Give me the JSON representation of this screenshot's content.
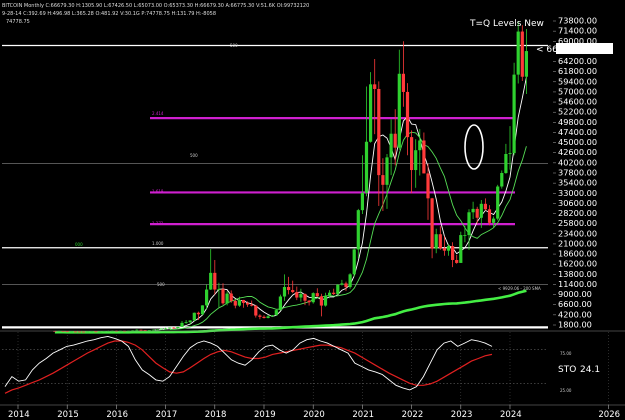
{
  "header": {
    "line1": "BITCOIN Monthly  C:66679.30  H:1305.90  L:67426.50  L:65073.00  O:65373.30  H:66679.30  A:66775.30  V:51.6K  OI:99732120",
    "line2": "9-28-14  C:392.69  H:496.98  L:365.28  O:481.92  V:30.1G  P:74778.75  H:131.79  H:-8058",
    "line3": "74778.75",
    "overlay_title": "T=Q Levels New"
  },
  "price_tag": "< 66679.3",
  "labels": {
    "level_500_top": "500",
    "level_2414": "2.414",
    "level_500_mid": "500",
    "level_1618": "1.618",
    "level_1272": "1.272",
    "level_1000": "1.000",
    "level_500_low": "500",
    "note_left": "000",
    "sma_label": "< 9929.06 - 200 SMA",
    "stoch_label": "STO",
    "stoch_value": "24.1",
    "stoch_80": "75.00",
    "stoch_20": "25.00"
  },
  "colors": {
    "up": "#2fd12f",
    "down": "#ff3a3a",
    "fib": "#d020d0",
    "white_line": "#ffffff",
    "ma_fast": "#ffffff",
    "ma_mid": "#55dd55",
    "ma_slow": "#44ee44",
    "stoch_k": "#ffffff",
    "stoch_d": "#e02020"
  },
  "chart_data": {
    "type": "candlestick",
    "title": "T=Q Levels New",
    "y_tick_labels": [
      "73800.00",
      "71400.00",
      "69000.00",
      "66600.00",
      "64200.00",
      "61800.00",
      "59400.00",
      "57000.00",
      "54600.00",
      "52200.00",
      "49800.00",
      "47400.00",
      "45000.00",
      "42600.00",
      "40200.00",
      "37800.00",
      "35400.00",
      "33000.00",
      "30600.00",
      "28200.00",
      "25800.00",
      "23400.00",
      "21000.00",
      "18600.00",
      "16200.00",
      "13800.00",
      "11400.00",
      "9000.00",
      "6600.00",
      "4200.00",
      "1800.00"
    ],
    "x_tick_labels": [
      "2014",
      "2015",
      "2016",
      "2017",
      "2018",
      "2019",
      "2020",
      "2021",
      "2022",
      "2023",
      "2024",
      "2026"
    ],
    "ylim": [
      0,
      75000
    ],
    "last_price": 66679.3,
    "candles": [
      {
        "t": "2014-10",
        "o": 390,
        "h": 400,
        "l": 310,
        "c": 340
      },
      {
        "t": "2014-11",
        "o": 340,
        "h": 460,
        "l": 320,
        "c": 380
      },
      {
        "t": "2014-12",
        "o": 380,
        "h": 390,
        "l": 300,
        "c": 320
      },
      {
        "t": "2015-01",
        "o": 320,
        "h": 320,
        "l": 150,
        "c": 220
      },
      {
        "t": "2015-02",
        "o": 220,
        "h": 270,
        "l": 210,
        "c": 255
      },
      {
        "t": "2015-03",
        "o": 255,
        "h": 300,
        "l": 240,
        "c": 245
      },
      {
        "t": "2015-04",
        "o": 245,
        "h": 260,
        "l": 210,
        "c": 235
      },
      {
        "t": "2015-05",
        "o": 235,
        "h": 250,
        "l": 225,
        "c": 230
      },
      {
        "t": "2015-06",
        "o": 230,
        "h": 265,
        "l": 220,
        "c": 262
      },
      {
        "t": "2015-07",
        "o": 262,
        "h": 315,
        "l": 255,
        "c": 285
      },
      {
        "t": "2015-08",
        "o": 285,
        "h": 290,
        "l": 200,
        "c": 230
      },
      {
        "t": "2015-09",
        "o": 230,
        "h": 245,
        "l": 225,
        "c": 237
      },
      {
        "t": "2015-10",
        "o": 237,
        "h": 330,
        "l": 235,
        "c": 312
      },
      {
        "t": "2015-11",
        "o": 312,
        "h": 495,
        "l": 300,
        "c": 377
      },
      {
        "t": "2015-12",
        "o": 377,
        "h": 470,
        "l": 350,
        "c": 430
      },
      {
        "t": "2016-01",
        "o": 430,
        "h": 460,
        "l": 350,
        "c": 370
      },
      {
        "t": "2016-02",
        "o": 370,
        "h": 445,
        "l": 365,
        "c": 437
      },
      {
        "t": "2016-03",
        "o": 437,
        "h": 440,
        "l": 410,
        "c": 416
      },
      {
        "t": "2016-04",
        "o": 416,
        "h": 465,
        "l": 415,
        "c": 448
      },
      {
        "t": "2016-05",
        "o": 448,
        "h": 550,
        "l": 440,
        "c": 531
      },
      {
        "t": "2016-06",
        "o": 531,
        "h": 780,
        "l": 530,
        "c": 670
      },
      {
        "t": "2016-07",
        "o": 670,
        "h": 700,
        "l": 600,
        "c": 624
      },
      {
        "t": "2016-08",
        "o": 624,
        "h": 630,
        "l": 540,
        "c": 573
      },
      {
        "t": "2016-09",
        "o": 573,
        "h": 615,
        "l": 570,
        "c": 608
      },
      {
        "t": "2016-10",
        "o": 608,
        "h": 720,
        "l": 605,
        "c": 698
      },
      {
        "t": "2016-11",
        "o": 698,
        "h": 750,
        "l": 690,
        "c": 745
      },
      {
        "t": "2016-12",
        "o": 745,
        "h": 975,
        "l": 740,
        "c": 965
      },
      {
        "t": "2017-01",
        "o": 965,
        "h": 1150,
        "l": 750,
        "c": 970
      },
      {
        "t": "2017-02",
        "o": 970,
        "h": 1200,
        "l": 920,
        "c": 1190
      },
      {
        "t": "2017-03",
        "o": 1190,
        "h": 1300,
        "l": 890,
        "c": 1080
      },
      {
        "t": "2017-04",
        "o": 1080,
        "h": 1350,
        "l": 1060,
        "c": 1350
      },
      {
        "t": "2017-05",
        "o": 1350,
        "h": 2750,
        "l": 1340,
        "c": 2300
      },
      {
        "t": "2017-06",
        "o": 2300,
        "h": 2980,
        "l": 2100,
        "c": 2480
      },
      {
        "t": "2017-07",
        "o": 2480,
        "h": 2930,
        "l": 1830,
        "c": 2870
      },
      {
        "t": "2017-08",
        "o": 2870,
        "h": 4750,
        "l": 2680,
        "c": 4700
      },
      {
        "t": "2017-09",
        "o": 4700,
        "h": 4980,
        "l": 2980,
        "c": 4340
      },
      {
        "t": "2017-10",
        "o": 4340,
        "h": 6470,
        "l": 4150,
        "c": 6450
      },
      {
        "t": "2017-11",
        "o": 6450,
        "h": 11400,
        "l": 5500,
        "c": 10200
      },
      {
        "t": "2017-12",
        "o": 10200,
        "h": 19800,
        "l": 10100,
        "c": 14150
      },
      {
        "t": "2018-01",
        "o": 14150,
        "h": 17200,
        "l": 9000,
        "c": 10200
      },
      {
        "t": "2018-02",
        "o": 10200,
        "h": 11800,
        "l": 6000,
        "c": 10300
      },
      {
        "t": "2018-03",
        "o": 10300,
        "h": 11700,
        "l": 6600,
        "c": 6930
      },
      {
        "t": "2018-04",
        "o": 6930,
        "h": 9750,
        "l": 6450,
        "c": 9240
      },
      {
        "t": "2018-05",
        "o": 9240,
        "h": 9990,
        "l": 7050,
        "c": 7500
      },
      {
        "t": "2018-06",
        "o": 7500,
        "h": 7770,
        "l": 5750,
        "c": 6390
      },
      {
        "t": "2018-07",
        "o": 6390,
        "h": 8500,
        "l": 6100,
        "c": 7730
      },
      {
        "t": "2018-08",
        "o": 7730,
        "h": 7760,
        "l": 5880,
        "c": 7030
      },
      {
        "t": "2018-09",
        "o": 7030,
        "h": 7400,
        "l": 6100,
        "c": 6630
      },
      {
        "t": "2018-10",
        "o": 6630,
        "h": 7600,
        "l": 6200,
        "c": 6370
      },
      {
        "t": "2018-11",
        "o": 6370,
        "h": 6570,
        "l": 3560,
        "c": 4040
      },
      {
        "t": "2018-12",
        "o": 4040,
        "h": 4350,
        "l": 3150,
        "c": 3740
      },
      {
        "t": "2019-01",
        "o": 3740,
        "h": 4100,
        "l": 3350,
        "c": 3460
      },
      {
        "t": "2019-02",
        "o": 3460,
        "h": 4200,
        "l": 3380,
        "c": 3850
      },
      {
        "t": "2019-03",
        "o": 3850,
        "h": 4150,
        "l": 3680,
        "c": 4100
      },
      {
        "t": "2019-04",
        "o": 4100,
        "h": 5600,
        "l": 4050,
        "c": 5320
      },
      {
        "t": "2019-05",
        "o": 5320,
        "h": 9000,
        "l": 5300,
        "c": 8550
      },
      {
        "t": "2019-06",
        "o": 8550,
        "h": 13800,
        "l": 7500,
        "c": 10800
      },
      {
        "t": "2019-07",
        "o": 10800,
        "h": 13200,
        "l": 9050,
        "c": 10080
      },
      {
        "t": "2019-08",
        "o": 10080,
        "h": 12300,
        "l": 9350,
        "c": 9600
      },
      {
        "t": "2019-09",
        "o": 9600,
        "h": 10900,
        "l": 7700,
        "c": 8300
      },
      {
        "t": "2019-10",
        "o": 8300,
        "h": 10400,
        "l": 7300,
        "c": 9150
      },
      {
        "t": "2019-11",
        "o": 9150,
        "h": 9270,
        "l": 6500,
        "c": 7550
      },
      {
        "t": "2019-12",
        "o": 7550,
        "h": 7750,
        "l": 6430,
        "c": 7190
      },
      {
        "t": "2020-01",
        "o": 7190,
        "h": 9550,
        "l": 6860,
        "c": 9350
      },
      {
        "t": "2020-02",
        "o": 9350,
        "h": 10500,
        "l": 8450,
        "c": 8600
      },
      {
        "t": "2020-03",
        "o": 8600,
        "h": 9200,
        "l": 3850,
        "c": 6400
      },
      {
        "t": "2020-04",
        "o": 6400,
        "h": 9450,
        "l": 6150,
        "c": 8650
      },
      {
        "t": "2020-05",
        "o": 8650,
        "h": 10070,
        "l": 8130,
        "c": 9450
      },
      {
        "t": "2020-06",
        "o": 9450,
        "h": 10400,
        "l": 8900,
        "c": 9140
      },
      {
        "t": "2020-07",
        "o": 9140,
        "h": 11450,
        "l": 8950,
        "c": 11350
      },
      {
        "t": "2020-08",
        "o": 11350,
        "h": 12480,
        "l": 11150,
        "c": 11650
      },
      {
        "t": "2020-09",
        "o": 11650,
        "h": 12070,
        "l": 9880,
        "c": 10780
      },
      {
        "t": "2020-10",
        "o": 10780,
        "h": 14100,
        "l": 10400,
        "c": 13800
      },
      {
        "t": "2020-11",
        "o": 13800,
        "h": 19900,
        "l": 13200,
        "c": 19700
      },
      {
        "t": "2020-12",
        "o": 19700,
        "h": 29300,
        "l": 17600,
        "c": 29000
      },
      {
        "t": "2021-01",
        "o": 29000,
        "h": 42000,
        "l": 28100,
        "c": 33100
      },
      {
        "t": "2021-02",
        "o": 33100,
        "h": 58300,
        "l": 32300,
        "c": 45200
      },
      {
        "t": "2021-03",
        "o": 45200,
        "h": 61700,
        "l": 45000,
        "c": 58800
      },
      {
        "t": "2021-04",
        "o": 58800,
        "h": 64800,
        "l": 47000,
        "c": 57700
      },
      {
        "t": "2021-05",
        "o": 57700,
        "h": 59500,
        "l": 30000,
        "c": 37300
      },
      {
        "t": "2021-06",
        "o": 37300,
        "h": 41300,
        "l": 28800,
        "c": 35000
      },
      {
        "t": "2021-07",
        "o": 35000,
        "h": 42300,
        "l": 29300,
        "c": 41500
      },
      {
        "t": "2021-08",
        "o": 41500,
        "h": 50500,
        "l": 37300,
        "c": 47100
      },
      {
        "t": "2021-09",
        "o": 47100,
        "h": 52900,
        "l": 39600,
        "c": 43800
      },
      {
        "t": "2021-10",
        "o": 43800,
        "h": 67000,
        "l": 43300,
        "c": 61300
      },
      {
        "t": "2021-11",
        "o": 61300,
        "h": 69000,
        "l": 53500,
        "c": 57000
      },
      {
        "t": "2021-12",
        "o": 57000,
        "h": 59100,
        "l": 42000,
        "c": 46300
      },
      {
        "t": "2022-01",
        "o": 46300,
        "h": 47900,
        "l": 33000,
        "c": 38500
      },
      {
        "t": "2022-02",
        "o": 38500,
        "h": 45800,
        "l": 34300,
        "c": 43200
      },
      {
        "t": "2022-03",
        "o": 43200,
        "h": 48200,
        "l": 37200,
        "c": 45500
      },
      {
        "t": "2022-04",
        "o": 45500,
        "h": 47400,
        "l": 37700,
        "c": 37700
      },
      {
        "t": "2022-05",
        "o": 37700,
        "h": 40000,
        "l": 26700,
        "c": 31800
      },
      {
        "t": "2022-06",
        "o": 31800,
        "h": 31900,
        "l": 17600,
        "c": 19900
      },
      {
        "t": "2022-07",
        "o": 19900,
        "h": 24600,
        "l": 18800,
        "c": 23300
      },
      {
        "t": "2022-08",
        "o": 23300,
        "h": 25200,
        "l": 19600,
        "c": 20000
      },
      {
        "t": "2022-09",
        "o": 20000,
        "h": 22800,
        "l": 18200,
        "c": 19400
      },
      {
        "t": "2022-10",
        "o": 19400,
        "h": 21000,
        "l": 18200,
        "c": 20500
      },
      {
        "t": "2022-11",
        "o": 20500,
        "h": 21400,
        "l": 15500,
        "c": 17200
      },
      {
        "t": "2022-12",
        "o": 17200,
        "h": 18400,
        "l": 16300,
        "c": 16500
      },
      {
        "t": "2023-01",
        "o": 16500,
        "h": 23900,
        "l": 16500,
        "c": 23100
      },
      {
        "t": "2023-02",
        "o": 23100,
        "h": 25300,
        "l": 21400,
        "c": 23100
      },
      {
        "t": "2023-03",
        "o": 23100,
        "h": 29200,
        "l": 19600,
        "c": 28500
      },
      {
        "t": "2023-04",
        "o": 28500,
        "h": 31000,
        "l": 26900,
        "c": 29300
      },
      {
        "t": "2023-05",
        "o": 29300,
        "h": 29800,
        "l": 25800,
        "c": 27200
      },
      {
        "t": "2023-06",
        "o": 27200,
        "h": 31400,
        "l": 24800,
        "c": 30500
      },
      {
        "t": "2023-07",
        "o": 30500,
        "h": 31800,
        "l": 28900,
        "c": 29200
      },
      {
        "t": "2023-08",
        "o": 29200,
        "h": 30200,
        "l": 25400,
        "c": 26000
      },
      {
        "t": "2023-09",
        "o": 26000,
        "h": 27500,
        "l": 24900,
        "c": 27000
      },
      {
        "t": "2023-10",
        "o": 27000,
        "h": 35000,
        "l": 26600,
        "c": 34600
      },
      {
        "t": "2023-11",
        "o": 34600,
        "h": 38400,
        "l": 34100,
        "c": 37800
      },
      {
        "t": "2023-12",
        "o": 37800,
        "h": 44700,
        "l": 37600,
        "c": 42300
      },
      {
        "t": "2024-01",
        "o": 42300,
        "h": 48900,
        "l": 38600,
        "c": 42500
      },
      {
        "t": "2024-02",
        "o": 42500,
        "h": 63900,
        "l": 42000,
        "c": 61100
      },
      {
        "t": "2024-03",
        "o": 61100,
        "h": 73800,
        "l": 59000,
        "c": 71300
      },
      {
        "t": "2024-04",
        "o": 71300,
        "h": 72800,
        "l": 59600,
        "c": 60600
      },
      {
        "t": "2024-05",
        "o": 60600,
        "h": 71900,
        "l": 56500,
        "c": 66679.3
      }
    ],
    "levels": [
      {
        "name": "500",
        "value": 68000,
        "color": "#ffffff"
      },
      {
        "name": "2.414",
        "value": 50800,
        "color": "#d020d0"
      },
      {
        "name": "500",
        "value": 40000,
        "color": "#888888"
      },
      {
        "name": "1.618",
        "value": 33200,
        "color": "#d020d0"
      },
      {
        "name": "1.272",
        "value": 25700,
        "color": "#d020d0"
      },
      {
        "name": "1.000",
        "value": 20100,
        "color": "#ffffff"
      },
      {
        "name": "500",
        "value": 11400,
        "color": "#888888"
      },
      {
        "name": "",
        "value": 1100,
        "color": "#ffffff"
      }
    ],
    "sma200_last": 9929.06,
    "stochastic": {
      "k": [
        20,
        35,
        28,
        30,
        45,
        55,
        62,
        70,
        75,
        80,
        82,
        85,
        88,
        90,
        93,
        95,
        92,
        88,
        80,
        60,
        45,
        38,
        30,
        28,
        35,
        50,
        65,
        78,
        85,
        88,
        85,
        80,
        70,
        60,
        55,
        52,
        60,
        72,
        80,
        82,
        75,
        70,
        75,
        85,
        90,
        92,
        88,
        85,
        80,
        75,
        70,
        55,
        50,
        45,
        42,
        38,
        30,
        22,
        18,
        15,
        20,
        35,
        55,
        75,
        85,
        88,
        80,
        85,
        90,
        88,
        85,
        80
      ],
      "d": [
        10,
        15,
        18,
        22,
        26,
        30,
        35,
        40,
        46,
        52,
        58,
        64,
        70,
        75,
        80,
        85,
        88,
        88,
        86,
        82,
        75,
        65,
        55,
        48,
        42,
        40,
        42,
        48,
        55,
        62,
        68,
        72,
        74,
        72,
        68,
        64,
        62,
        62,
        64,
        68,
        70,
        72,
        74,
        76,
        78,
        80,
        82,
        82,
        80,
        78,
        74,
        70,
        64,
        58,
        52,
        46,
        40,
        35,
        30,
        25,
        22,
        22,
        24,
        28,
        34,
        40,
        46,
        52,
        58,
        62,
        66,
        68
      ],
      "k_last": 24.1
    }
  }
}
